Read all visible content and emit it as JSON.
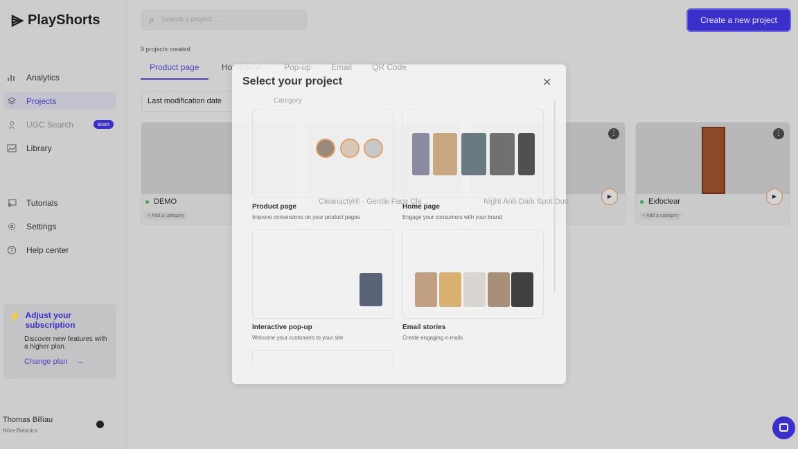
{
  "app": {
    "name": "PlayShorts"
  },
  "sidebar": {
    "items": [
      {
        "label": "Analytics"
      },
      {
        "label": "Projects"
      },
      {
        "label": "UGC Search",
        "badge": "soon"
      },
      {
        "label": "Library"
      },
      {
        "label": "Tutorials"
      },
      {
        "label": "Settings"
      },
      {
        "label": "Help center"
      }
    ],
    "promo": {
      "title": "Adjust your subscription",
      "text": "Discover new features with a higher plan.",
      "link": "Change plan"
    },
    "user": {
      "name": "Thomas Billiau",
      "company": "Nüra Botanics"
    }
  },
  "header": {
    "search_placeholder": "Search a project ...",
    "create_button": "Create a new project"
  },
  "main": {
    "count": "9 projects created",
    "tabs": [
      "Product page",
      "Homepage",
      "Pop-up",
      "Email",
      "QR Code"
    ],
    "sort": "Last modification date",
    "category": "Category",
    "projects": [
      {
        "name": "DEMO",
        "category": "+ Add a category"
      },
      {
        "name": "Cleanactyl® - Gentle Face Cle..."
      },
      {
        "name": "Night Anti-Dark Spot Duo"
      },
      {
        "name": "Exfoclear",
        "category": "+ Add a category"
      }
    ]
  },
  "modal": {
    "title": "Select your project",
    "options": [
      {
        "label": "Product page",
        "desc": "Improve conversions on your product pages"
      },
      {
        "label": "Home page",
        "desc": "Engage your consumers with your brand"
      },
      {
        "label": "Interactive pop-up",
        "desc": "Welcome your customers to your site"
      },
      {
        "label": "Email stories",
        "desc": "Create engaging e-mails"
      }
    ]
  },
  "colors": {
    "accent": "#3a2fc8"
  }
}
